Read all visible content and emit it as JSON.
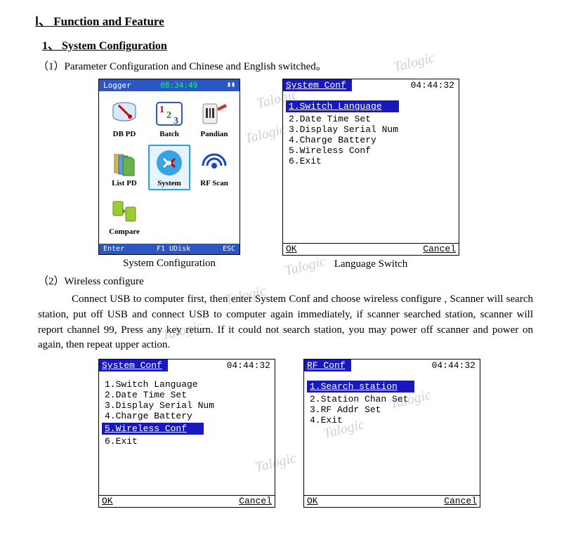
{
  "headings": {
    "main": "Ⅰ、 Function and Feature",
    "sub1": "1、 System Configuration",
    "item1": "（1）Parameter Configuration and Chinese and English switched。",
    "item2": "（2）Wireless configure",
    "body2": "Connect USB to computer first, then enter System Conf and choose wireless configure , Scanner will search station, put off USB and connect USB to computer again immediately, if scanner searched station, scanner will report channel 99, Press any key return. If it could not search station, you may power off scanner and power on again, then repeat upper action."
  },
  "captions": {
    "sysconf": "System Configuration",
    "langswitch": "Language Switch"
  },
  "device": {
    "headerLeft": "Logger",
    "headerTime": "08:34:49",
    "footerLeft": "Enter",
    "footerMid": "F1 UDisk",
    "footerRight": "ESC",
    "icons": [
      {
        "label": "DB PD",
        "name": "db-pd-icon"
      },
      {
        "label": "Batch",
        "name": "batch-icon"
      },
      {
        "label": "Pandian",
        "name": "pandian-icon"
      },
      {
        "label": "List PD",
        "name": "list-pd-icon"
      },
      {
        "label": "System",
        "name": "system-icon",
        "selected": true
      },
      {
        "label": "RF Scan",
        "name": "rf-scan-icon"
      },
      {
        "label": "Compare",
        "name": "compare-icon"
      }
    ]
  },
  "menuA": {
    "title": "System Conf",
    "time": "04:44:32",
    "items": [
      {
        "text": "1.Switch Language",
        "selected": true
      },
      {
        "text": "2.Date Time Set"
      },
      {
        "text": "3.Display Serial Num"
      },
      {
        "text": "4.Charge Battery"
      },
      {
        "text": "5.Wireless Conf"
      },
      {
        "text": "6.Exit"
      }
    ],
    "ok": "OK",
    "cancel": "Cancel"
  },
  "menuB": {
    "title": "System Conf",
    "time": "04:44:32",
    "items": [
      {
        "text": "1.Switch Language"
      },
      {
        "text": "2.Date Time Set"
      },
      {
        "text": "3.Display Serial Num"
      },
      {
        "text": "4.Charge Battery"
      },
      {
        "text": "5.Wireless Conf",
        "selected": true
      },
      {
        "text": "6.Exit"
      }
    ],
    "ok": "OK",
    "cancel": "Cancel"
  },
  "menuC": {
    "title": "RF Conf",
    "time": "04:44:32",
    "items": [
      {
        "text": "1.Search station",
        "selected": true
      },
      {
        "text": "2.Station Chan Set"
      },
      {
        "text": "3.RF Addr Set"
      },
      {
        "text": "4.Exit"
      }
    ],
    "ok": "OK",
    "cancel": "Cancel"
  },
  "watermark": "Talogic"
}
